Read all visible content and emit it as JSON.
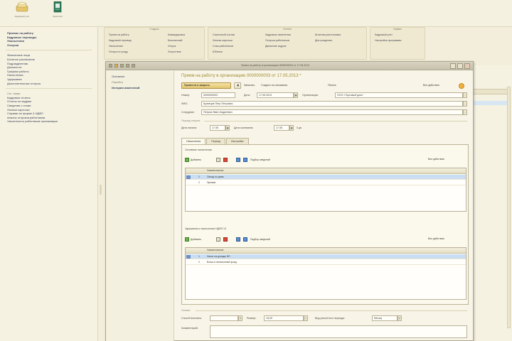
{
  "toolbar": {
    "buttons": [
      {
        "label": "Кадровый учет",
        "icon": "folder-stack-icon",
        "color": "#c9a44a"
      },
      {
        "label": "Зарплата",
        "icon": "ledger-book-icon",
        "color": "#2e7d5a"
      }
    ]
  },
  "sections": {
    "group1": [
      "Приемы на работу",
      "Кадровые переводы",
      "Увольнения",
      "Отпуска"
    ],
    "group2": [
      "Физические лица",
      "Штатное расписание",
      "Подразделения",
      "Должности",
      "Графики работы",
      "Начисления",
      "Удержания",
      "Дополнительные отпуска"
    ],
    "group3_title": "См. также",
    "group3": [
      "Кадровые отчеты",
      "Отчеты по кадрам",
      "Сведения о стаже",
      "Личные карточки",
      "Справки по форме 2-НДФЛ",
      "Анализ отпусков работников",
      "Численность работников организации"
    ]
  },
  "function_panel": {
    "groups": [
      {
        "title": "Создать",
        "col1": [
          "Прием на работу",
          "Кадровый перевод",
          "Увольнение",
          "Отпуск по уходу"
        ],
        "col2": [
          "Командировка",
          "Больничный",
          "Отпуск",
          "Отсутствие"
        ]
      },
      {
        "title": "Отчеты",
        "col1": [
          "Списочный состав",
          "Личная карточка",
          "Стаж работников",
          "Юбилеи"
        ],
        "col2": [
          "Кадровые изменения",
          "Отпуска работников",
          "Движение кадров"
        ],
        "col3": [
          "Штатная расстановка",
          "Дни рождения"
        ]
      },
      {
        "title": "Сервис",
        "col1": [
          "Кадровый учет",
          "Настройка программы"
        ]
      }
    ]
  },
  "doc_window": {
    "title": "Прием на работу в организацию 0000000003 от 17.05.2013",
    "nav": [
      "Основное",
      "Перейти",
      "История изменений"
    ],
    "heading": "Прием на работу в организацию 0000000003 от 17.05.2013 *",
    "toolbar": {
      "post_close": "Провести и закрыть",
      "write": "Записать",
      "create_based": "Создать на основании",
      "print": "Печать",
      "all_actions": "Все действия"
    },
    "fields": {
      "number_label": "Номер:",
      "number_value": "0000000003",
      "date_label": "Дата:",
      "date_value": "17.05.2013",
      "org_label": "Организация:",
      "org_value": "ООО «Торговый дом»",
      "person_label": "ФИО:",
      "person_value": "Кузнецов Петр Петрович",
      "employee_label": "Сотрудник:",
      "employee_value": "Петров Иван Андреевич"
    },
    "period": {
      "group_title": "Период отпуска",
      "from_label": "Дата начала:",
      "from_value": "17.05",
      "to_label": "Дата окончания:",
      "to_value": "17.05",
      "days": "0 дн."
    },
    "tabs": [
      "Начисления",
      "Период",
      "Настройка"
    ],
    "accruals": {
      "title": "Основные начисления",
      "add": "Добавить",
      "pick": "Подбор сведений",
      "all_actions": "Все действия",
      "column": "Наименование",
      "rows": [
        {
          "n": "1",
          "name": "Оклад по дням",
          "selected": true
        },
        {
          "n": "2",
          "name": "Премия",
          "selected": false
        }
      ]
    },
    "deductions": {
      "title": "Удержания и начисления НДФЛ 13",
      "add": "Добавить",
      "pick": "Подбор сведений",
      "all_actions": "Все действия",
      "column": "Наименование",
      "rows": [
        {
          "n": "1",
          "name": "Налог на доходы ФЛ",
          "selected": true
        },
        {
          "n": "2",
          "name": "Взнос в пенсионный фонд",
          "selected": false
        }
      ]
    },
    "footer": {
      "group_title": "Оплата",
      "pay_label": "Способ выплаты:",
      "rate_label": "Размер:",
      "rate_value": "15,00",
      "method_label": "Вид расчетного периода:",
      "method_value": "Месяц",
      "comment_label": "Комментарий:"
    }
  },
  "colors": {
    "accent_heading": "#a08a2e",
    "primary_button": "#e2c46f",
    "selection": "#c9ddf3",
    "background": "#f3eedb"
  }
}
